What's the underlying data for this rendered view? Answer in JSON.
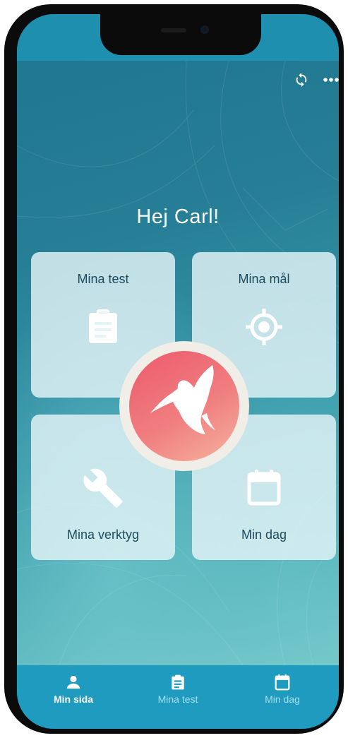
{
  "header": {
    "sync_icon": "sync-icon",
    "menu_icon": "more-horizontal-icon"
  },
  "greeting": "Hej Carl!",
  "tiles": [
    {
      "label": "Mina test",
      "icon": "clipboard-icon"
    },
    {
      "label": "Mina mål",
      "icon": "target-icon"
    },
    {
      "label": "Mina verktyg",
      "icon": "wrench-icon"
    },
    {
      "label": "Min dag",
      "icon": "calendar-icon"
    }
  ],
  "logo": {
    "icon": "hummingbird-icon",
    "colors": [
      "#ec5a6d",
      "#f6b39e"
    ]
  },
  "nav": {
    "items": [
      {
        "label": "Min sida",
        "icon": "person-icon",
        "active": true
      },
      {
        "label": "Mina test",
        "icon": "clipboard-icon",
        "active": false
      },
      {
        "label": "Min dag",
        "icon": "calendar-icon",
        "active": false
      }
    ]
  },
  "colors": {
    "background": "#267f97",
    "navbar": "#1f9bc0",
    "card_text": "#1d4b5e",
    "icon_white": "#ffffff"
  }
}
